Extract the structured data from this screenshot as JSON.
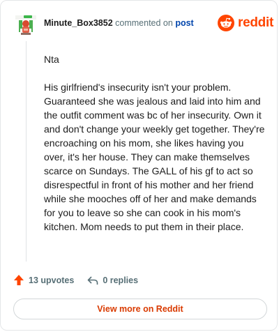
{
  "comment": {
    "username": "Minute_Box3852",
    "action_text": "commented on",
    "post_link": "post",
    "paragraphs": [
      "Nta",
      "His girlfriend's insecurity isn't your problem. Guaranteed she was jealous and laid into him and the outfit comment was bc of her insecurity. Own it and don't change your weekly get together. They're encroaching on his mom, she likes having you over, it's her house. They can make themselves scarce on Sundays. The GALL of his gf to act so disrespectful in front of his mother and her friend while she mooches off of her and make demands for you to leave so she can cook in his mom's kitchen. Mom needs to put them in their place."
    ],
    "upvotes": "13 upvotes",
    "replies": "0 replies"
  },
  "brand": {
    "name": "reddit",
    "accent": "#ff4500"
  },
  "footer": {
    "view_more": "View more on Reddit"
  },
  "icons": [
    "avatar",
    "reddit-logo-icon",
    "upvote-arrow-icon",
    "reply-icon"
  ]
}
